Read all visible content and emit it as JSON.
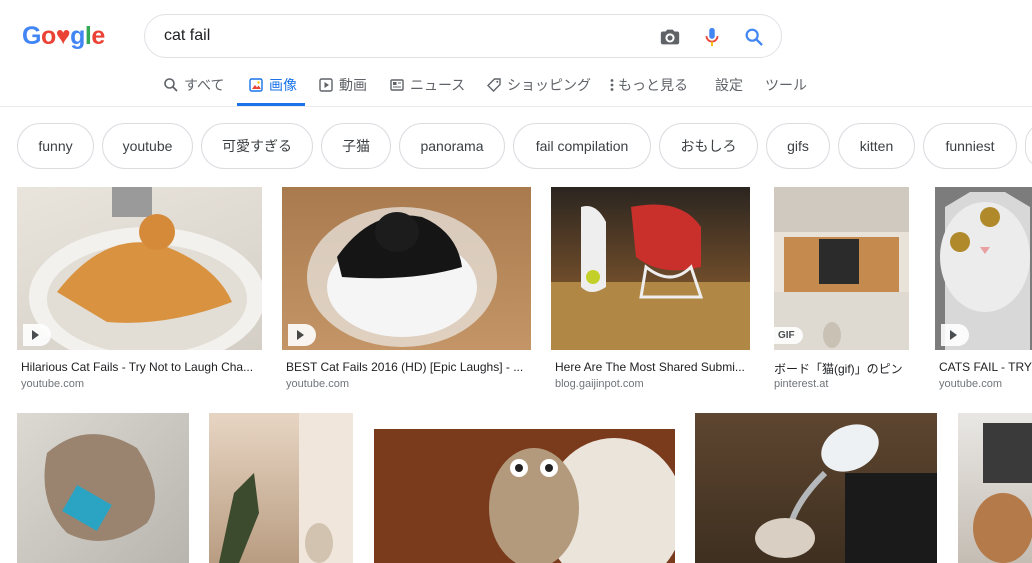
{
  "logo": {
    "letters": [
      "G",
      "o",
      "♥",
      "g",
      "l",
      "e"
    ],
    "colors": [
      "#4285f4",
      "#ea4335",
      "#ea4335",
      "#4285f4",
      "#34a853",
      "#ea4335"
    ]
  },
  "search": {
    "query": "cat fail"
  },
  "tabs": [
    {
      "label": "すべて",
      "icon": "search-icon"
    },
    {
      "label": "画像",
      "icon": "image-icon",
      "active": true
    },
    {
      "label": "動画",
      "icon": "video-icon"
    },
    {
      "label": "ニュース",
      "icon": "news-icon"
    },
    {
      "label": "ショッピング",
      "icon": "tag-icon"
    },
    {
      "label": "もっと見る",
      "icon": "more-vert-icon"
    },
    {
      "label": "設定"
    },
    {
      "label": "ツール"
    }
  ],
  "chips": [
    "funny",
    "youtube",
    "可愛すぎる",
    "子猫",
    "panorama",
    "fail compilation",
    "おもしろ",
    "gifs",
    "kitten",
    "funniest"
  ],
  "results_row1": [
    {
      "title": "Hilarious Cat Fails - Try Not to Laugh Cha...",
      "domain": "youtube.com",
      "badge": "play"
    },
    {
      "title": "BEST Cat Fails 2016 (HD) [Epic Laughs] - ...",
      "domain": "youtube.com",
      "badge": "play"
    },
    {
      "title": "Here Are The Most Shared Submi...",
      "domain": "blog.gaijinpot.com",
      "badge": ""
    },
    {
      "title": "ボード「猫(gif)」のピン",
      "domain": "pinterest.at",
      "badge": "GIF"
    },
    {
      "title": "CATS FAIL - TRY",
      "domain": "youtube.com",
      "badge": "play"
    }
  ],
  "colors": {
    "accent": "#1a73e8",
    "text": "#202124",
    "muted": "#70757a"
  }
}
